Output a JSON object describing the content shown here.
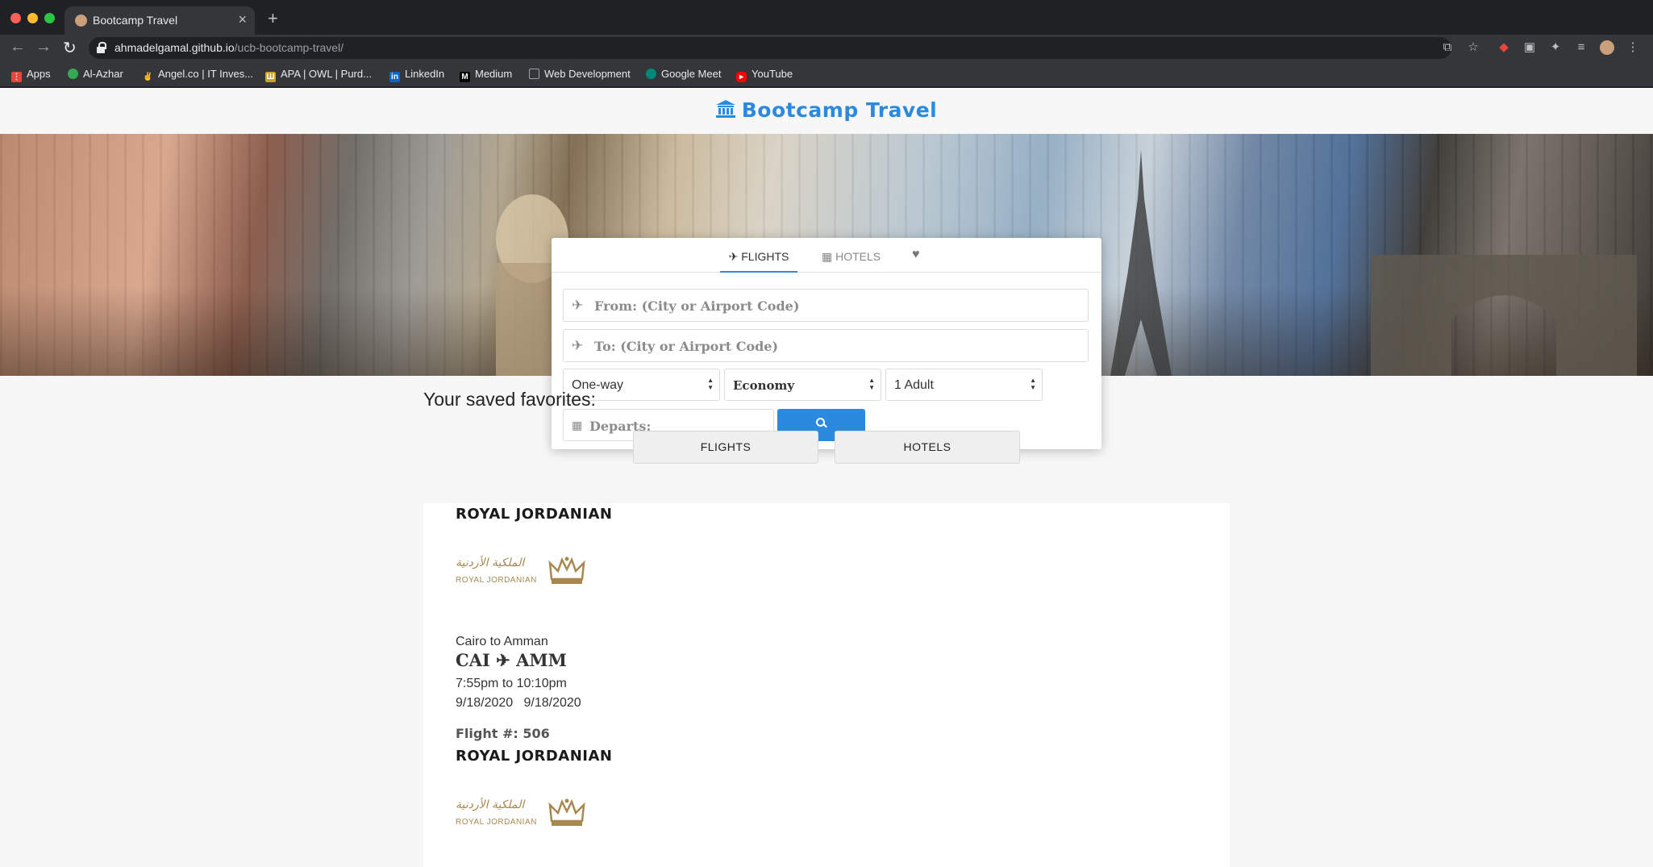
{
  "browser": {
    "tab_title": "Bootcamp Travel",
    "url_host": "ahmadelgamal.github.io",
    "url_path": "/ucb-bootcamp-travel/",
    "bookmarks": [
      {
        "label": "Apps",
        "icon": "apps-grid-icon",
        "color": "#e8453c"
      },
      {
        "label": "Al-Azhar",
        "icon": "al-azhar-icon",
        "color": "#34a853"
      },
      {
        "label": "Angel.co | IT Inves...",
        "icon": "angel-icon",
        "color": "#e8eaed"
      },
      {
        "label": "APA | OWL | Purd...",
        "icon": "owl-icon",
        "color": "#c9a227"
      },
      {
        "label": "LinkedIn",
        "icon": "linkedin-icon",
        "color": "#0a66c2"
      },
      {
        "label": "Medium",
        "icon": "medium-icon",
        "color": "#000000"
      },
      {
        "label": "Web Development",
        "icon": "folder-icon",
        "color": "#9aa0a6"
      },
      {
        "label": "Google Meet",
        "icon": "google-meet-icon",
        "color": "#00897b"
      },
      {
        "label": "YouTube",
        "icon": "youtube-icon",
        "color": "#ff0000"
      }
    ]
  },
  "site": {
    "brand": "Bootcamp Travel",
    "accent_color": "#2b8ade"
  },
  "search": {
    "tabs": {
      "flights": "FLIGHTS",
      "hotels": "HOTELS"
    },
    "from_placeholder": "From: (City or Airport Code)",
    "to_placeholder": "To: (City or Airport Code)",
    "trip_type": "One-way",
    "cabin_class": "Economy",
    "passengers": "1 Adult",
    "departs_placeholder": "Departs:"
  },
  "favorites": {
    "heading": "Your saved favorites:",
    "flights_button": "FLIGHTS",
    "hotels_button": "HOTELS",
    "items": [
      {
        "airline": "ROYAL JORDANIAN",
        "logo_arabic": "الملكية الأردنية",
        "logo_latin": "ROYAL JORDANIAN",
        "route": "Cairo to Amman",
        "from_code": "CAI",
        "to_code": "AMM",
        "times": "7:55pm to 10:10pm",
        "dates": "9/18/2020   9/18/2020",
        "flight_number": "Flight #: 506"
      },
      {
        "airline": "ROYAL JORDANIAN",
        "logo_arabic": "الملكية الأردنية",
        "logo_latin": "ROYAL JORDANIAN"
      }
    ]
  }
}
